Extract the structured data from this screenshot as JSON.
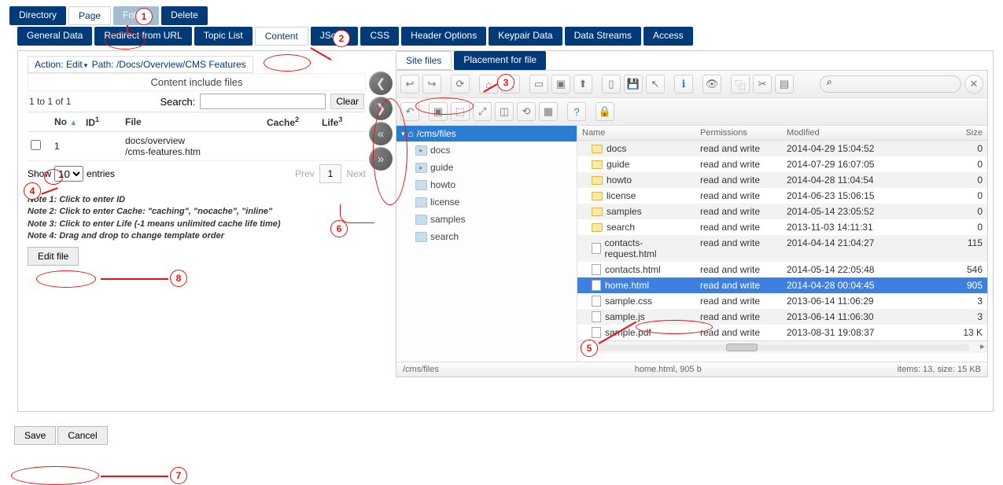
{
  "topTabs": {
    "directory": "Directory",
    "page": "Page",
    "folder": "Folder",
    "delete": "Delete"
  },
  "secondTabs": [
    "General Data",
    "Redirect from URL",
    "Topic List",
    "Content",
    "JScript",
    "CSS",
    "Header Options",
    "Keypair Data",
    "Data Streams",
    "Access"
  ],
  "actionPath": {
    "label_action": "Action:",
    "action": "Edit",
    "label_path": "Path:",
    "path": "/Docs/Overview/CMS Features"
  },
  "includeHeading": "Content include files",
  "search": {
    "countLabel": "1 to 1 of 1",
    "label": "Search:",
    "clear": "Clear",
    "value": ""
  },
  "tableHeaders": {
    "no": "No",
    "id": "ID",
    "file": "File",
    "cache": "Cache",
    "life": "Life"
  },
  "tableRow": {
    "no": "1",
    "file_line1": "docs/overview",
    "file_line2": "/cms-features.htm"
  },
  "showEntries": {
    "show": "Show",
    "value": "10",
    "entries": "entries"
  },
  "pager": {
    "prev": "Prev",
    "page": "1",
    "next": "Next"
  },
  "notes": {
    "n1": "Note 1: Click to enter ID",
    "n2": "Note 2: Click to enter Cache: \"caching\", \"nocache\", \"inline\"",
    "n3": "Note 3: Click to enter Life (-1 means unlimited cache life time)",
    "n4": "Note 4: Drag and drop to change template order"
  },
  "editFile": "Edit file",
  "rightTabs": {
    "site": "Site files",
    "placement": "Placement for file"
  },
  "treeRoot": "/cms/files",
  "treeChildren": [
    "docs",
    "guide",
    "howto",
    "license",
    "samples",
    "search"
  ],
  "listHead": {
    "name": "Name",
    "perm": "Permissions",
    "mod": "Modified",
    "size": "Size"
  },
  "files": [
    {
      "name": "docs",
      "type": "folder",
      "perm": "read and write",
      "mod": "2014-04-29 15:04:52",
      "size": "0"
    },
    {
      "name": "guide",
      "type": "folder",
      "perm": "read and write",
      "mod": "2014-07-29 16:07:05",
      "size": "0"
    },
    {
      "name": "howto",
      "type": "folder",
      "perm": "read and write",
      "mod": "2014-04-28 11:04:54",
      "size": "0"
    },
    {
      "name": "license",
      "type": "folder",
      "perm": "read and write",
      "mod": "2014-06-23 15:06:15",
      "size": "0"
    },
    {
      "name": "samples",
      "type": "folder",
      "perm": "read and write",
      "mod": "2014-05-14 23:05:52",
      "size": "0"
    },
    {
      "name": "search",
      "type": "folder",
      "perm": "read and write",
      "mod": "2013-11-03 14:11:31",
      "size": "0"
    },
    {
      "name": "contacts-request.html",
      "type": "file",
      "perm": "read and write",
      "mod": "2014-04-14 21:04:27",
      "size": "115"
    },
    {
      "name": "contacts.html",
      "type": "file",
      "perm": "read and write",
      "mod": "2014-05-14 22:05:48",
      "size": "546"
    },
    {
      "name": "home.html",
      "type": "file",
      "perm": "read and write",
      "mod": "2014-04-28 00:04:45",
      "size": "905",
      "selected": true
    },
    {
      "name": "sample.css",
      "type": "file",
      "perm": "read and write",
      "mod": "2013-06-14 11:06:29",
      "size": "3"
    },
    {
      "name": "sample.js",
      "type": "file",
      "perm": "read and write",
      "mod": "2013-06-14 11:06:30",
      "size": "3"
    },
    {
      "name": "sample.pdf",
      "type": "file",
      "perm": "read and write",
      "mod": "2013-08-31 19:08:37",
      "size": "13 K"
    }
  ],
  "statusBar": {
    "left": "/cms/files",
    "mid": "home.html, 905 b",
    "right": "items: 13, size: 15 KB"
  },
  "searchPlaceholder": "⌕",
  "bottomActions": {
    "save": "Save",
    "cancel": "Cancel"
  },
  "callouts": {
    "1": "1",
    "2": "2",
    "3": "3",
    "4": "4",
    "5": "5",
    "6": "6",
    "7": "7",
    "8": "8"
  }
}
